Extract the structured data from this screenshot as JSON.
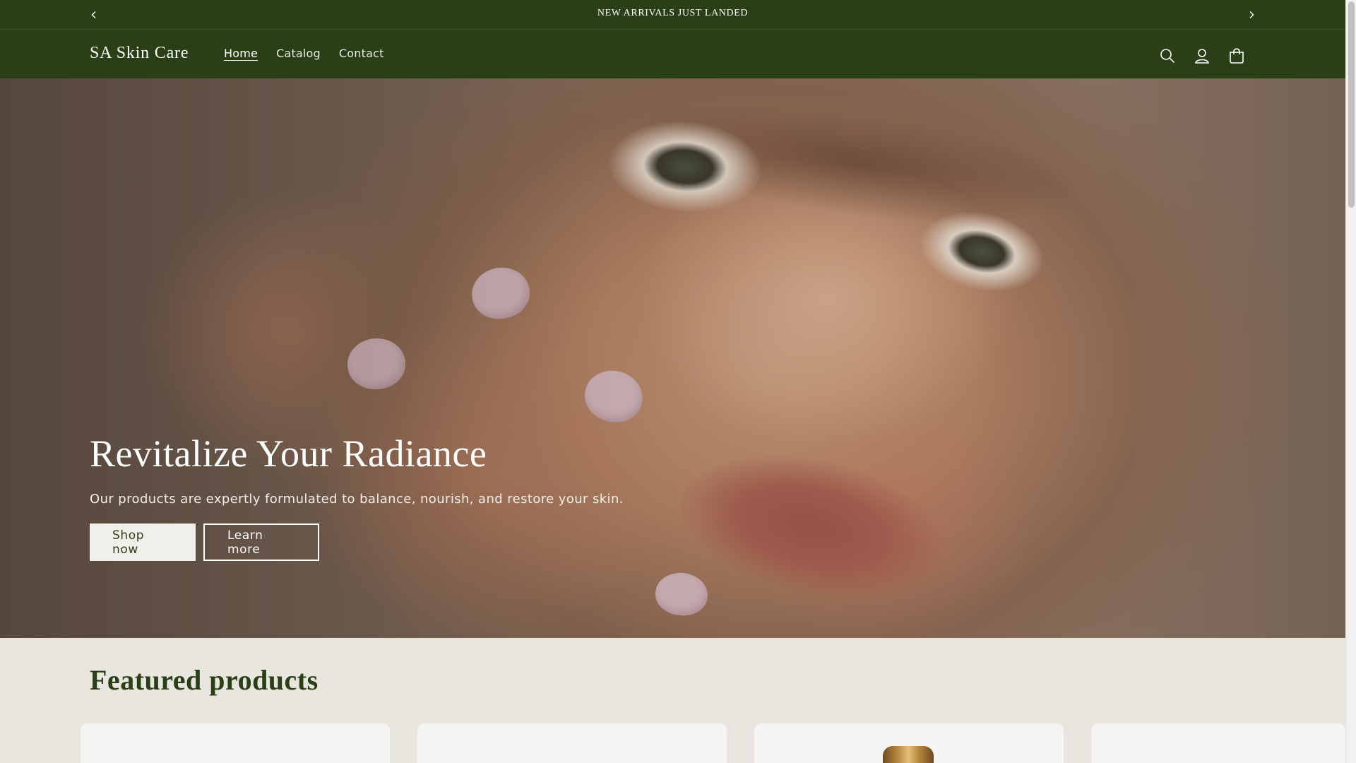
{
  "announcement": {
    "text": "NEW ARRIVALS JUST LANDED",
    "prev_icon": "chevron-left-icon",
    "next_icon": "chevron-right-icon"
  },
  "header": {
    "logo": "SA Skin Care",
    "nav": [
      {
        "label": "Home",
        "active": true
      },
      {
        "label": "Catalog",
        "active": false
      },
      {
        "label": "Contact",
        "active": false
      }
    ],
    "icons": [
      "search-icon",
      "account-icon",
      "cart-icon"
    ]
  },
  "hero": {
    "title": "Revitalize Your Radiance",
    "subtitle": "Our products are expertly formulated to balance, nourish, and restore your skin.",
    "primary_button": "Shop now",
    "secondary_button": "Learn more"
  },
  "featured": {
    "title": "Featured products"
  },
  "colors": {
    "brand_green": "#2b3f17",
    "page_background": "#e8e6df",
    "card_background": "#f4f4f2",
    "button_light": "#f1efea"
  }
}
